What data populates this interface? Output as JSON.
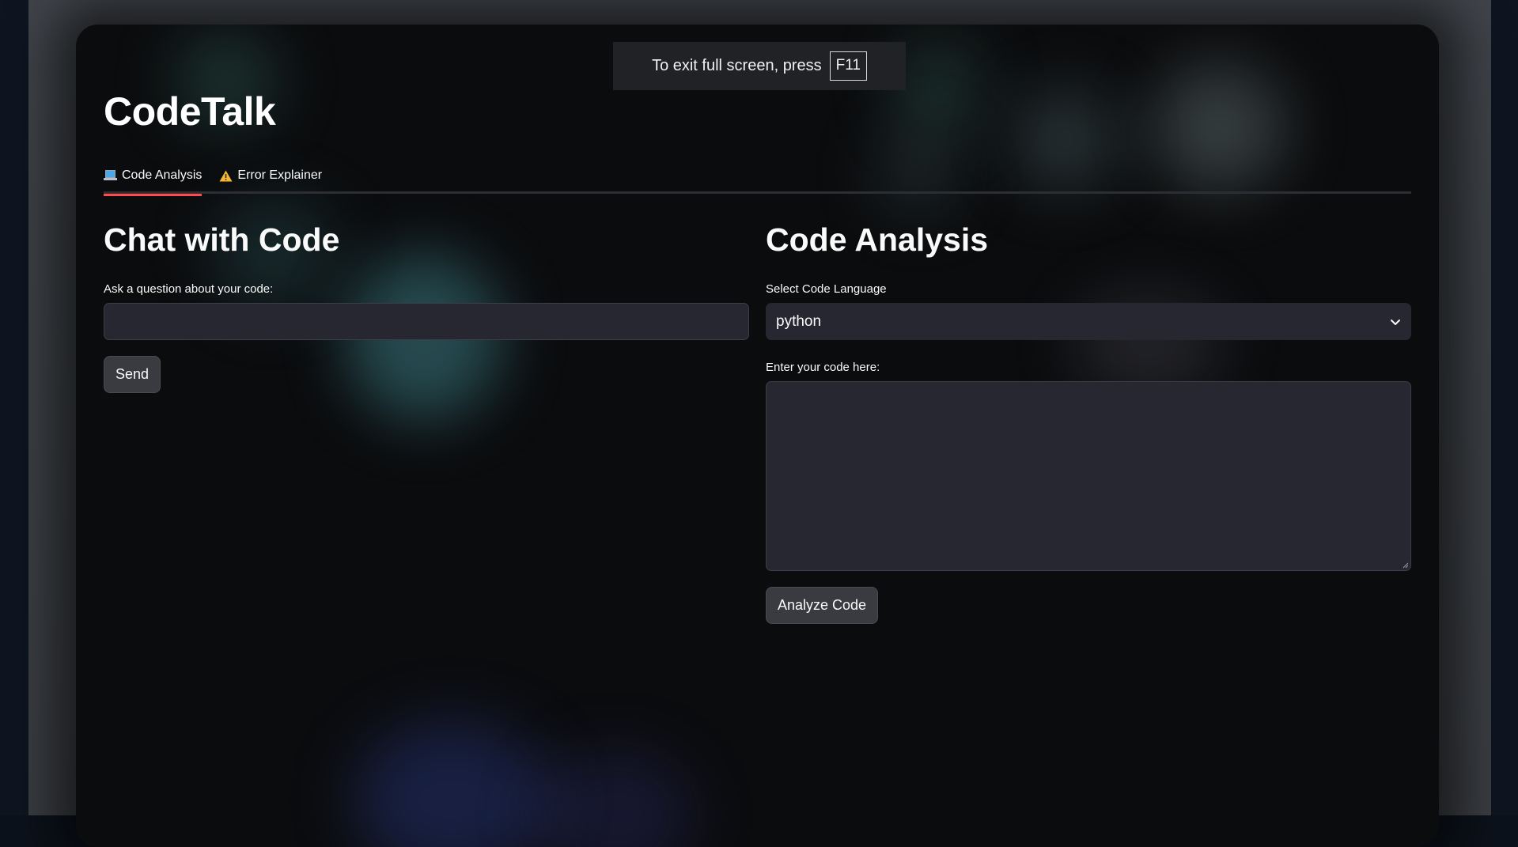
{
  "fullscreen_notice": {
    "text": "To exit full screen, press",
    "key": "F11"
  },
  "app": {
    "title": "CodeTalk"
  },
  "tabs": [
    {
      "label": "Code Analysis",
      "icon": "laptop-icon",
      "active": true
    },
    {
      "label": "Error Explainer",
      "icon": "warning-icon",
      "active": false
    }
  ],
  "chat": {
    "heading": "Chat with Code",
    "question_label": "Ask a question about your code:",
    "question_value": "",
    "send_label": "Send"
  },
  "analysis": {
    "heading": "Code Analysis",
    "language_label": "Select Code Language",
    "language_value": "python",
    "code_label": "Enter your code here:",
    "code_value": "",
    "analyze_label": "Analyze Code"
  },
  "colors": {
    "accent": "#ff4b4b",
    "panel_bg": "#0b0c0e",
    "input_bg": "#262730",
    "button_bg": "#3a3b41"
  }
}
